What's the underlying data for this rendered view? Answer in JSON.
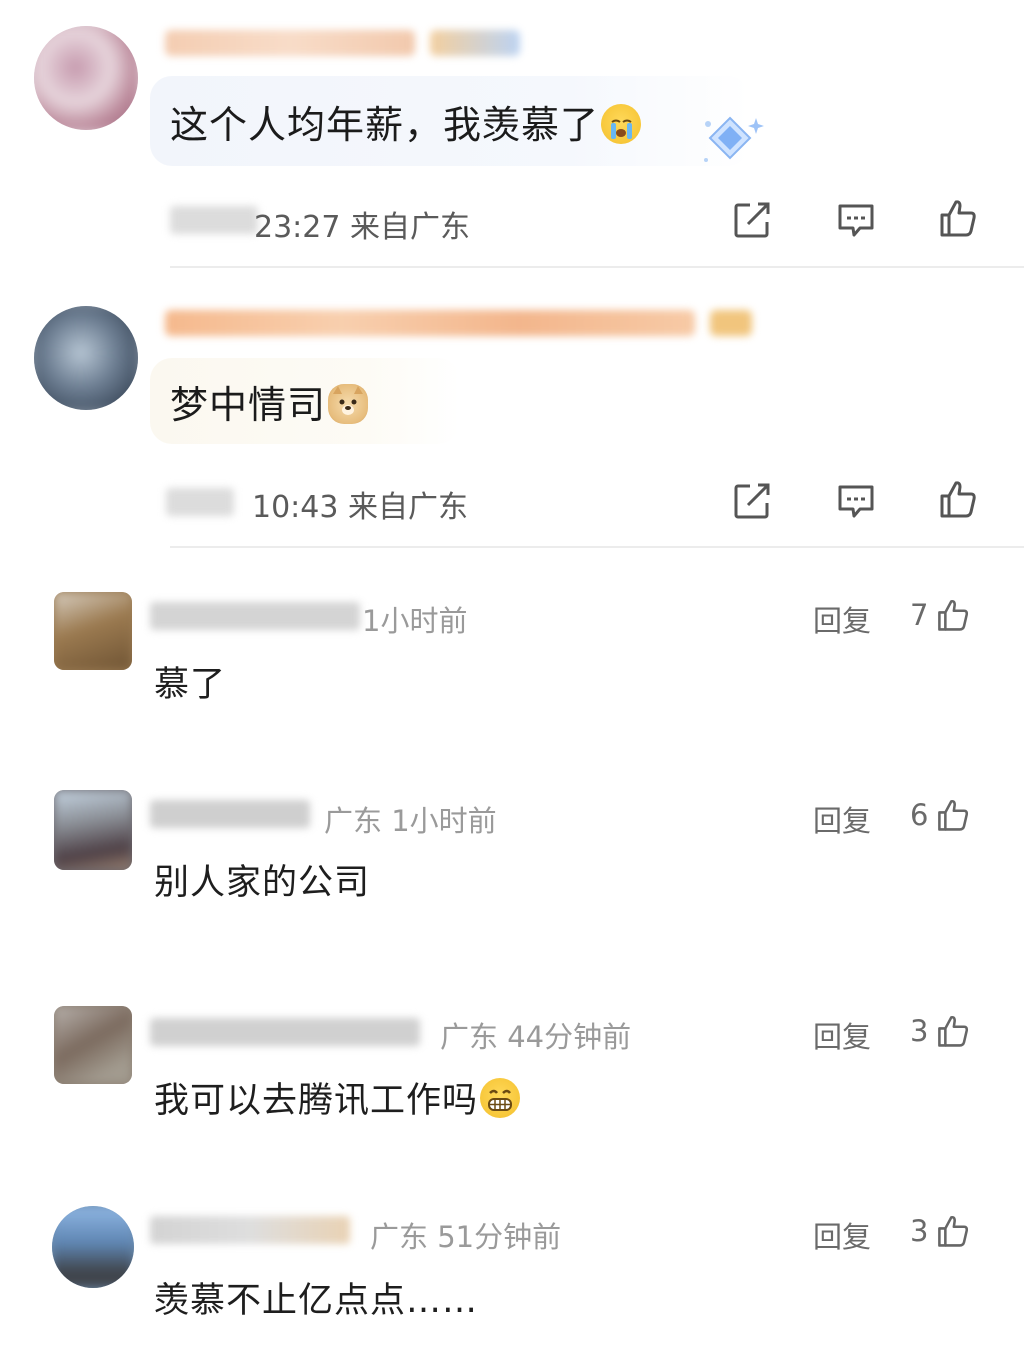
{
  "top_comments": [
    {
      "text": "这个人均年薪，我羡慕了",
      "time": "23:27",
      "location": "来自广东"
    },
    {
      "text": "梦中情司",
      "time": "10:43",
      "location": "来自广东"
    }
  ],
  "list_comments": [
    {
      "meta": "1小时前",
      "text": "慕了",
      "reply_label": "回复",
      "likes": "7"
    },
    {
      "meta": "广东 1小时前",
      "text": "别人家的公司",
      "reply_label": "回复",
      "likes": "6"
    },
    {
      "meta": "广东 44分钟前",
      "text": "我可以去腾讯工作吗",
      "reply_label": "回复",
      "likes": "3"
    },
    {
      "meta": "广东 51分钟前",
      "text": "羡慕不止亿点点……",
      "reply_label": "回复",
      "likes": "3"
    }
  ],
  "icons": {
    "share": "share-icon",
    "comment": "comment-icon",
    "like": "thumbs-up-icon",
    "emoji_crying": "crying-emoji-icon",
    "emoji_doge": "doge-emoji-icon",
    "emoji_grin": "grin-emoji-icon",
    "badge": "diamond-badge-icon"
  },
  "colors": {
    "accent_text": "#1b1b1b",
    "meta_text": "#9a9a9a",
    "bubble_blue": "#f2f5fb",
    "bubble_yellow": "#fbf8f0"
  }
}
